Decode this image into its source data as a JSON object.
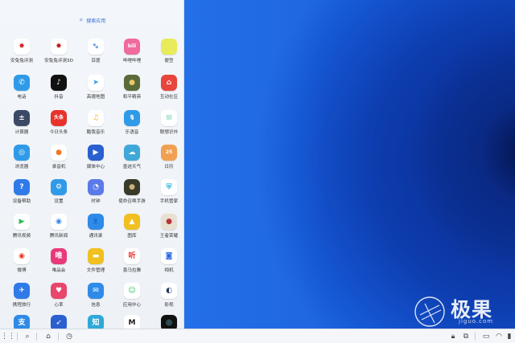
{
  "drawer": {
    "search_placeholder": "搜索应用",
    "search_icon": "search-icon"
  },
  "apps": [
    {
      "id": "app-anquantu",
      "label": "安兔兔评测",
      "bg": "#ffffff",
      "glyph": "✸",
      "fg": "#d8232a",
      "icon": "fire-ant-icon"
    },
    {
      "id": "app-anquantu-3d",
      "label": "安兔兔评测3D",
      "bg": "#ffffff",
      "glyph": "✸",
      "fg": "#c01c22",
      "icon": "fire-ant-icon"
    },
    {
      "id": "app-baidu",
      "label": "百度",
      "bg": "#ffffff",
      "glyph": "🐾",
      "fg": "#2e5fd8",
      "icon": "paw-icon"
    },
    {
      "id": "app-bilibili",
      "label": "哔哩哔哩",
      "bg": "#f06aa0",
      "glyph": "bili",
      "fg": "#ffffff",
      "icon": "bilibili-icon"
    },
    {
      "id": "app-bianqian",
      "label": "便签",
      "bg": "#e8ec5a",
      "glyph": "",
      "fg": "#ffffff",
      "icon": "note-icon"
    },
    {
      "id": "app-dianhua",
      "label": "电话",
      "bg": "#2f9ae8",
      "glyph": "✆",
      "fg": "#ffffff",
      "icon": "phone-icon"
    },
    {
      "id": "app-douyin",
      "label": "抖音",
      "bg": "#111111",
      "glyph": "♪",
      "fg": "#ffffff",
      "icon": "douyin-icon"
    },
    {
      "id": "app-gaode",
      "label": "高德地图",
      "bg": "#ffffff",
      "glyph": "➤",
      "fg": "#2f9ae8",
      "icon": "map-arrow-icon"
    },
    {
      "id": "app-hepingjingying",
      "label": "和平精英",
      "bg": "#5a6a3a",
      "glyph": "●",
      "fg": "#e8c86a",
      "icon": "game-icon"
    },
    {
      "id": "app-hudong",
      "label": "互动社区",
      "bg": "#e8453c",
      "glyph": "⌂",
      "fg": "#ffffff",
      "icon": "community-icon"
    },
    {
      "id": "app-jisuanqi",
      "label": "计算器",
      "bg": "#3a4a66",
      "glyph": "±",
      "fg": "#ffffff",
      "icon": "calculator-icon"
    },
    {
      "id": "app-jinritoutiao",
      "label": "今日头条",
      "bg": "#e8322c",
      "glyph": "头条",
      "fg": "#ffffff",
      "icon": "toutiao-icon"
    },
    {
      "id": "app-kugou",
      "label": "酷我音乐",
      "bg": "#ffffff",
      "glyph": "♫",
      "fg": "#f0b21e",
      "icon": "music-icon"
    },
    {
      "id": "app-leyuyin",
      "label": "乐语音",
      "bg": "#2f9ae8",
      "glyph": "🎙",
      "fg": "#ffffff",
      "icon": "microphone-icon"
    },
    {
      "id": "app-lianxiang",
      "label": "联想识外",
      "bg": "#ffffff",
      "glyph": "|||",
      "fg": "#2fbf8a",
      "icon": "lenovo-icon"
    },
    {
      "id": "app-liulanqi",
      "label": "浏览器",
      "bg": "#2f9ae8",
      "glyph": "◎",
      "fg": "#ffffff",
      "icon": "browser-icon"
    },
    {
      "id": "app-luyinji",
      "label": "录音机",
      "bg": "#ffffff",
      "glyph": "●",
      "fg": "#f07a2a",
      "icon": "recorder-icon"
    },
    {
      "id": "app-meiti",
      "label": "媒体中心",
      "bg": "#2a5fd0",
      "glyph": "▶",
      "fg": "#ffffff",
      "icon": "media-icon"
    },
    {
      "id": "app-moji",
      "label": "墨迹天气",
      "bg": "#3fa8d8",
      "glyph": "☁",
      "fg": "#ffffff",
      "icon": "weather-icon"
    },
    {
      "id": "app-rili",
      "label": "日历",
      "bg": "#f0a050",
      "glyph": "25",
      "fg": "#ffffff",
      "icon": "calendar-icon"
    },
    {
      "id": "app-shebeibangzhu",
      "label": "设备帮助",
      "bg": "#2f7ae8",
      "glyph": "?",
      "fg": "#ffffff",
      "icon": "help-icon"
    },
    {
      "id": "app-shezhi",
      "label": "设置",
      "bg": "#2f9ae8",
      "glyph": "⚙",
      "fg": "#ffffff",
      "icon": "gear-icon"
    },
    {
      "id": "app-shizhong",
      "label": "时钟",
      "bg": "#5a7ae8",
      "glyph": "◔",
      "fg": "#ffffff",
      "icon": "clock-icon"
    },
    {
      "id": "app-shijue",
      "label": "使命召唤手游",
      "bg": "#3a3a2a",
      "glyph": "●",
      "fg": "#c9b37a",
      "icon": "game-icon"
    },
    {
      "id": "app-shoujiguanjia",
      "label": "手机管家",
      "bg": "#ffffff",
      "glyph": "⛨",
      "fg": "#2fb5e8",
      "icon": "shield-icon"
    },
    {
      "id": "app-tengxunshipin",
      "label": "腾讯视频",
      "bg": "#ffffff",
      "glyph": "▶",
      "fg": "#2fbf5a",
      "icon": "video-icon"
    },
    {
      "id": "app-tengxunxinwen",
      "label": "腾讯新闻",
      "bg": "#ffffff",
      "glyph": "◉",
      "fg": "#2f8ae8",
      "icon": "news-icon"
    },
    {
      "id": "app-tongxunlu",
      "label": "通讯录",
      "bg": "#2f8ae8",
      "glyph": "👤",
      "fg": "#ffffff",
      "icon": "contacts-icon"
    },
    {
      "id": "app-tuku",
      "label": "图库",
      "bg": "#f0c020",
      "glyph": "▲",
      "fg": "#ffffff",
      "icon": "gallery-icon"
    },
    {
      "id": "app-wangzhe",
      "label": "王者荣耀",
      "bg": "#e8e0d0",
      "glyph": "●",
      "fg": "#b8343a",
      "icon": "game-icon"
    },
    {
      "id": "app-weibo",
      "label": "微博",
      "bg": "#ffffff",
      "glyph": "◉",
      "fg": "#e8322c",
      "icon": "weibo-icon"
    },
    {
      "id": "app-weipinhui",
      "label": "唯品会",
      "bg": "#e83a7a",
      "glyph": "唯",
      "fg": "#ffffff",
      "icon": "vip-icon"
    },
    {
      "id": "app-wenjian",
      "label": "文件管理",
      "bg": "#f0c020",
      "glyph": "▬",
      "fg": "#ffffff",
      "icon": "folder-icon"
    },
    {
      "id": "app-ximalaya",
      "label": "喜马拉雅",
      "bg": "#ffffff",
      "glyph": "听",
      "fg": "#e8322c",
      "icon": "ximalaya-icon"
    },
    {
      "id": "app-xiangji",
      "label": "相机",
      "bg": "#ffffff",
      "glyph": "◙",
      "fg": "#2f6ae8",
      "icon": "camera-icon"
    },
    {
      "id": "app-xiecheng",
      "label": "携程旅行",
      "bg": "#2f7ae8",
      "glyph": "✈",
      "fg": "#ffffff",
      "icon": "travel-icon"
    },
    {
      "id": "app-xinlv",
      "label": "心率",
      "bg": "#e8466a",
      "glyph": "♥",
      "fg": "#ffffff",
      "icon": "heart-icon"
    },
    {
      "id": "app-xinxi",
      "label": "信息",
      "bg": "#2f8ae8",
      "glyph": "✉",
      "fg": "#ffffff",
      "icon": "message-icon"
    },
    {
      "id": "app-yingyong",
      "label": "应用中心",
      "bg": "#ffffff",
      "glyph": "☺",
      "fg": "#2fbf5a",
      "icon": "appstore-icon"
    },
    {
      "id": "app-yingshi",
      "label": "影视",
      "bg": "#ffffff",
      "glyph": "◐",
      "fg": "#2a3a66",
      "icon": "film-icon"
    },
    {
      "id": "app-zhifubao",
      "label": "",
      "bg": "#2f8ae8",
      "glyph": "支",
      "fg": "#ffffff",
      "icon": "alipay-icon"
    },
    {
      "id": "app-zhinanzhen",
      "label": "",
      "bg": "#2a5fd0",
      "glyph": "➶",
      "fg": "#ffffff",
      "icon": "compass-icon"
    },
    {
      "id": "app-zhishi",
      "label": "",
      "bg": "#2fa8d8",
      "glyph": "知",
      "fg": "#ffffff",
      "icon": "knowledge-icon"
    },
    {
      "id": "app-motorola",
      "label": "",
      "bg": "#ffffff",
      "glyph": "M",
      "fg": "#1a1a1a",
      "icon": "motorola-icon"
    },
    {
      "id": "app-ring",
      "label": "",
      "bg": "#111111",
      "glyph": "◎",
      "fg": "#6ad0f0",
      "icon": "ring-icon"
    }
  ],
  "taskbar": {
    "left_icons": [
      "apps-grid-icon",
      "search-icon",
      "home-icon",
      "clock-icon"
    ],
    "right_icons": [
      "lock-icon",
      "crop-icon",
      "window-icon",
      "monitor-icon",
      "wifi-icon",
      "battery-icon"
    ]
  },
  "watermark": {
    "brand_cn": "极果",
    "brand_en": "jiguo.com",
    "logo_icon": "jiguo-logo-icon"
  },
  "colors": {
    "accent": "#3a6fd0",
    "drawer_bg": "#f3f6fa",
    "wallpaper_base": "#1a5ed8",
    "wallpaper_dark": "#04134a"
  }
}
